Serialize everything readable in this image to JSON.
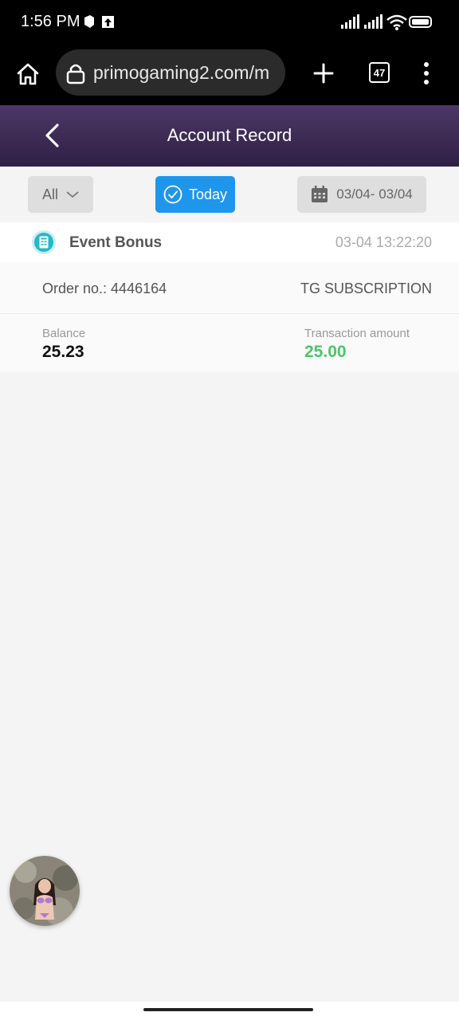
{
  "status_bar": {
    "time": "1:56 PM",
    "icons": [
      "app-notification-icon",
      "upload-notification-icon",
      "signal-icon",
      "signal-icon",
      "wifi-icon",
      "battery-icon"
    ]
  },
  "browser": {
    "url": "primogaming2.com/m",
    "tab_count": "47",
    "icons": [
      "home-icon",
      "lock-icon",
      "plus-icon",
      "more-vertical-icon"
    ]
  },
  "header": {
    "title": "Account Record",
    "back_icon": "chevron-left-icon"
  },
  "filters": {
    "type_label": "All",
    "today_label": "Today",
    "date_range": "03/04- 03/04"
  },
  "records": [
    {
      "title": "Event Bonus",
      "time": "03-04 13:22:20",
      "order_label": "Order no.: ",
      "order_no": "4446164",
      "type": "TG SUBSCRIPTION",
      "balance_label": "Balance",
      "balance": "25.23",
      "amount_label": "Transaction amount",
      "amount": "25.00"
    }
  ],
  "colors": {
    "header_gradient_top": "#4d3865",
    "header_gradient_bottom": "#2f1f45",
    "accent_blue": "#1e96ec",
    "amount_green": "#4cc56a",
    "record_icon": "#26b7c9"
  }
}
